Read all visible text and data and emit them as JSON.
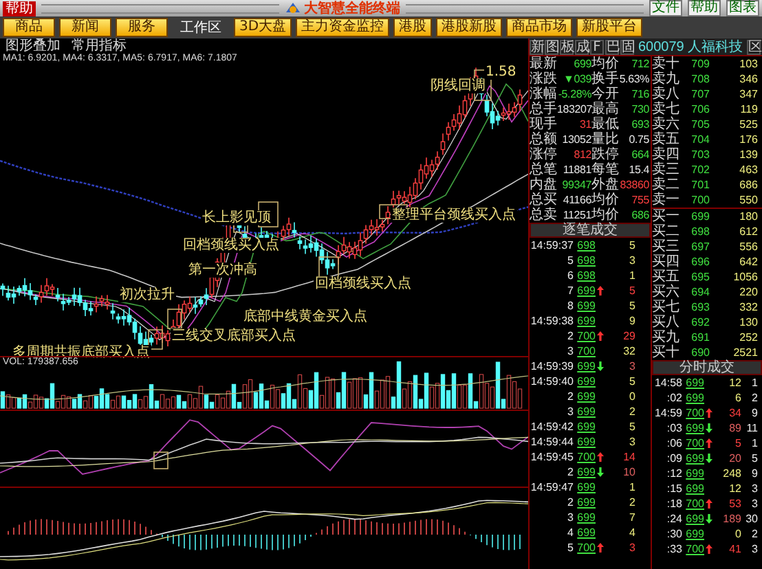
{
  "title_bar": {
    "tab": "帮助",
    "title": "大智慧全能终端",
    "buttons": [
      "文件",
      "帮助",
      "图表"
    ]
  },
  "toolbar": {
    "left_buttons": [
      "商品",
      "新闻",
      "服务"
    ],
    "workspace_label": "工作区",
    "right_buttons": [
      "3D大盘",
      "主力资金监控",
      "港股",
      "港股新股",
      "商品市场",
      "新股平台"
    ]
  },
  "chart": {
    "overlay_label": "图形叠加",
    "indicator_label": "常用指标",
    "ma_line": "MA1: 6.9201, MA4: 6.3317, MA5: 6.7917, MA6: 7.1807",
    "annotations": [
      {
        "text": "1.58"
      },
      {
        "text": "阴线回调"
      },
      {
        "text": "长上影见顶"
      },
      {
        "text": "整理平台颈线买入点"
      },
      {
        "text": "回档颈线买入点"
      },
      {
        "text": "第一次冲高"
      },
      {
        "text": "回档颈线买入点"
      },
      {
        "text": "初次拉升"
      },
      {
        "text": "底部中线黄金买入点"
      },
      {
        "text": "三线交叉底部买入点"
      },
      {
        "text": "多周期共振底部买入点"
      }
    ],
    "volume_label": "VOL: 179387.656"
  },
  "quote": {
    "buttons": [
      "新",
      "图",
      "板",
      "成",
      "F",
      "巴",
      "固"
    ],
    "symbol": "600079 人福科技",
    "close": "区",
    "items": [
      {
        "label": "最新",
        "value": "699",
        "color": "#40e040"
      },
      {
        "label": "均价",
        "value": "712",
        "color": "#40e040"
      },
      {
        "label": "涨跌",
        "value": "▼039",
        "color": "#40e040"
      },
      {
        "label": "换手",
        "value": "5.63%",
        "color": "#e8e8e8"
      },
      {
        "label": "涨幅",
        "value": "-5.28%",
        "color": "#40e040"
      },
      {
        "label": "今开",
        "value": "716",
        "color": "#40e040"
      },
      {
        "label": "总手",
        "value": "183207",
        "color": "#e8e8e8"
      },
      {
        "label": "最高",
        "value": "730",
        "color": "#40e040"
      },
      {
        "label": "现手",
        "value": "31",
        "color": "#ff4040"
      },
      {
        "label": "最低",
        "value": "693",
        "color": "#40e040"
      },
      {
        "label": "总额",
        "value": "13052",
        "color": "#e8e8e8"
      },
      {
        "label": "量比",
        "value": "0.75",
        "color": "#e8e8e8"
      },
      {
        "label": "涨停",
        "value": "812",
        "color": "#ff4040"
      },
      {
        "label": "跌停",
        "value": "664",
        "color": "#40e040"
      },
      {
        "label": "总笔",
        "value": "11881",
        "color": "#e8e8e8"
      },
      {
        "label": "每笔",
        "value": "15.4",
        "color": "#e8e8e8"
      },
      {
        "label": "内盘",
        "value": "99347",
        "color": "#40e040"
      },
      {
        "label": "外盘",
        "value": "83860",
        "color": "#ff4040"
      },
      {
        "label": "总买",
        "value": "41166",
        "color": "#e8e8e8"
      },
      {
        "label": "均价",
        "value": "755",
        "color": "#ff4040"
      },
      {
        "label": "总卖",
        "value": "11251",
        "color": "#e8e8e8"
      },
      {
        "label": "均价",
        "value": "686",
        "color": "#40e040"
      }
    ]
  },
  "order_book": [
    {
      "label": "卖十",
      "price": "709",
      "volume": "103"
    },
    {
      "label": "卖九",
      "price": "708",
      "volume": "346"
    },
    {
      "label": "卖八",
      "price": "707",
      "volume": "347"
    },
    {
      "label": "卖七",
      "price": "706",
      "volume": "119"
    },
    {
      "label": "卖六",
      "price": "705",
      "volume": "525"
    },
    {
      "label": "卖五",
      "price": "704",
      "volume": "176"
    },
    {
      "label": "卖四",
      "price": "703",
      "volume": "139"
    },
    {
      "label": "卖三",
      "price": "702",
      "volume": "463"
    },
    {
      "label": "卖二",
      "price": "701",
      "volume": "686"
    },
    {
      "label": "卖一",
      "price": "700",
      "volume": "550"
    },
    {
      "label": "买一",
      "price": "699",
      "volume": "180"
    },
    {
      "label": "买二",
      "price": "698",
      "volume": "612"
    },
    {
      "label": "买三",
      "price": "697",
      "volume": "556"
    },
    {
      "label": "买四",
      "price": "696",
      "volume": "642"
    },
    {
      "label": "买五",
      "price": "695",
      "volume": "1056"
    },
    {
      "label": "买六",
      "price": "694",
      "volume": "220"
    },
    {
      "label": "买七",
      "price": "693",
      "volume": "332"
    },
    {
      "label": "买八",
      "price": "692",
      "volume": "130"
    },
    {
      "label": "买九",
      "price": "691",
      "volume": "252"
    },
    {
      "label": "买十",
      "price": "690",
      "volume": "2521"
    }
  ],
  "tick_trades": {
    "title": "逐笔成交",
    "rows": [
      {
        "time": "14:59:37",
        "price": "698",
        "volume": "5",
        "rising": false,
        "falling": false
      },
      {
        "time": "5",
        "price": "698",
        "volume": "3",
        "rising": false,
        "falling": false
      },
      {
        "time": "6",
        "price": "698",
        "volume": "1",
        "rising": false,
        "falling": false
      },
      {
        "time": "7",
        "price": "699",
        "volume": "5",
        "rising": true,
        "falling": false
      },
      {
        "time": "8",
        "price": "699",
        "volume": "5",
        "rising": false,
        "falling": false
      },
      {
        "time": "14:59:38",
        "price": "699",
        "volume": "9",
        "rising": false,
        "falling": false
      },
      {
        "time": "2",
        "price": "700",
        "volume": "29",
        "rising": true,
        "falling": false
      },
      {
        "time": "3",
        "price": "700",
        "volume": "32",
        "rising": false,
        "falling": false
      },
      {
        "time": "14:59:39",
        "price": "699",
        "volume": "3",
        "rising": false,
        "falling": true
      },
      {
        "time": "14:59:40",
        "price": "699",
        "volume": "5",
        "rising": false,
        "falling": false
      },
      {
        "time": "2",
        "price": "699",
        "volume": "0",
        "rising": false,
        "falling": false
      },
      {
        "time": "3",
        "price": "699",
        "volume": "2",
        "rising": false,
        "falling": false
      },
      {
        "time": "14:59:42",
        "price": "699",
        "volume": "5",
        "rising": false,
        "falling": false
      },
      {
        "time": "14:59:44",
        "price": "699",
        "volume": "3",
        "rising": false,
        "falling": false
      },
      {
        "time": "14:59:45",
        "price": "700",
        "volume": "14",
        "rising": true,
        "falling": false
      },
      {
        "time": "2",
        "price": "699",
        "volume": "10",
        "rising": false,
        "falling": true
      },
      {
        "time": "14:59:47",
        "price": "699",
        "volume": "1",
        "rising": false,
        "falling": false
      },
      {
        "time": "2",
        "price": "699",
        "volume": "2",
        "rising": false,
        "falling": false
      },
      {
        "time": "3",
        "price": "699",
        "volume": "7",
        "rising": false,
        "falling": false
      },
      {
        "time": "4",
        "price": "699",
        "volume": "4",
        "rising": false,
        "falling": false
      },
      {
        "time": "5",
        "price": "700",
        "volume": "3",
        "rising": true,
        "falling": false
      }
    ]
  },
  "minute_trades": {
    "title": "分时成交",
    "rows": [
      {
        "time": "14:58",
        "price": "699",
        "volume": "12",
        "count": "1",
        "rising": false,
        "falling": false
      },
      {
        "time": ":02",
        "price": "699",
        "volume": "6",
        "count": "2",
        "rising": false,
        "falling": false
      },
      {
        "time": "14:59",
        "price": "700",
        "volume": "34",
        "count": "9",
        "rising": true,
        "falling": false
      },
      {
        "time": ":03",
        "price": "699",
        "volume": "89",
        "count": "11",
        "rising": false,
        "falling": true
      },
      {
        "time": ":06",
        "price": "700",
        "volume": "5",
        "count": "1",
        "rising": true,
        "falling": false
      },
      {
        "time": ":09",
        "price": "699",
        "volume": "20",
        "count": "5",
        "rising": false,
        "falling": true
      },
      {
        "time": ":12",
        "price": "699",
        "volume": "248",
        "count": "9",
        "rising": false,
        "falling": false
      },
      {
        "time": ":15",
        "price": "699",
        "volume": "12",
        "count": "3",
        "rising": false,
        "falling": false
      },
      {
        "time": ":18",
        "price": "700",
        "volume": "53",
        "count": "3",
        "rising": true,
        "falling": false
      },
      {
        "time": ":24",
        "price": "699",
        "volume": "189",
        "count": "30",
        "rising": false,
        "falling": true
      },
      {
        "time": ":30",
        "price": "699",
        "volume": "0",
        "count": "2",
        "rising": false,
        "falling": false
      },
      {
        "time": ":33",
        "price": "700",
        "volume": "41",
        "count": "3",
        "rising": true,
        "falling": false
      }
    ]
  }
}
